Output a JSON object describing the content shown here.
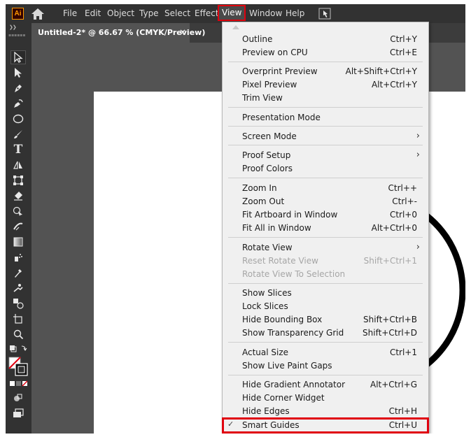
{
  "app": {
    "logo_text": "Ai",
    "accent_color": "#ff9a00",
    "highlight_color": "#e0000f"
  },
  "menubar": {
    "items": [
      "File",
      "Edit",
      "Object",
      "Type",
      "Select",
      "Effect",
      "View",
      "Window",
      "Help"
    ],
    "open_item": "View"
  },
  "tab": {
    "title": "Untitled-2* @ 66.67 % (CMYK/Preview)",
    "close": "×"
  },
  "toolbar": {
    "tools": [
      "selection-tool-icon",
      "direct-selection-tool-icon",
      "pen-tool-icon",
      "curvature-tool-icon",
      "ellipse-tool-icon",
      "paintbrush-tool-icon",
      "type-tool-icon",
      "reflect-tool-icon",
      "free-transform-tool-icon",
      "eraser-tool-icon",
      "shape-builder-tool-icon",
      "width-tool-icon",
      "gradient-tool-icon",
      "symbol-sprayer-tool-icon",
      "eyedropper-tool-icon",
      "puppet-warp-tool-icon",
      "blend-tool-icon",
      "artboard-tool-icon",
      "zoom-tool-icon"
    ],
    "more": "•••"
  },
  "view_menu": {
    "items": [
      {
        "label": "Outline",
        "shortcut": "Ctrl+Y"
      },
      {
        "label": "Preview on CPU",
        "shortcut": "Ctrl+E"
      },
      {
        "label": "Overprint Preview",
        "shortcut": "Alt+Shift+Ctrl+Y"
      },
      {
        "label": "Pixel Preview",
        "shortcut": "Alt+Ctrl+Y"
      },
      {
        "label": "Trim View",
        "shortcut": ""
      },
      {
        "label": "Presentation Mode",
        "shortcut": ""
      },
      {
        "label": "Screen Mode",
        "shortcut": "",
        "submenu": "›"
      },
      {
        "label": "Proof Setup",
        "shortcut": "",
        "submenu": "›"
      },
      {
        "label": "Proof Colors",
        "shortcut": ""
      },
      {
        "label": "Zoom In",
        "shortcut": "Ctrl++"
      },
      {
        "label": "Zoom Out",
        "shortcut": "Ctrl+-"
      },
      {
        "label": "Fit Artboard in Window",
        "shortcut": "Ctrl+0"
      },
      {
        "label": "Fit All in Window",
        "shortcut": "Alt+Ctrl+0"
      },
      {
        "label": "Rotate View",
        "shortcut": "",
        "submenu": "›"
      },
      {
        "label": "Reset Rotate View",
        "shortcut": "Shift+Ctrl+1",
        "disabled": true
      },
      {
        "label": "Rotate View To Selection",
        "shortcut": "",
        "disabled": true
      },
      {
        "label": "Show Slices",
        "shortcut": ""
      },
      {
        "label": "Lock Slices",
        "shortcut": ""
      },
      {
        "label": "Hide Bounding Box",
        "shortcut": "Shift+Ctrl+B"
      },
      {
        "label": "Show Transparency Grid",
        "shortcut": "Shift+Ctrl+D"
      },
      {
        "label": "Actual Size",
        "shortcut": "Ctrl+1"
      },
      {
        "label": "Show Live Paint Gaps",
        "shortcut": ""
      },
      {
        "label": "Hide Gradient Annotator",
        "shortcut": "Alt+Ctrl+G"
      },
      {
        "label": "Hide Corner Widget",
        "shortcut": ""
      },
      {
        "label": "Hide Edges",
        "shortcut": "Ctrl+H"
      },
      {
        "label": "Smart Guides",
        "shortcut": "Ctrl+U",
        "checked": true,
        "check": "✓"
      }
    ]
  }
}
